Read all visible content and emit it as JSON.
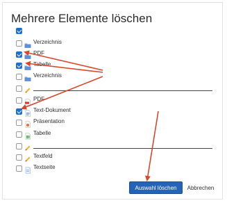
{
  "dialog": {
    "title": "Mehrere Elemente löschen",
    "select_all_checked": true,
    "items": [
      {
        "label": "Verzeichnis",
        "icon": "folder-icon",
        "checked": false
      },
      {
        "label": "PDF",
        "icon": "folder-icon",
        "checked": true
      },
      {
        "label": "Tabelle",
        "icon": "folder-icon",
        "checked": true
      },
      {
        "label": "Verzeichnis",
        "icon": "folder-icon",
        "checked": false
      },
      {
        "label": "",
        "icon": "pencil-icon",
        "checked": false
      },
      {
        "label": "PDF",
        "icon": "pdf-icon",
        "checked": false
      },
      {
        "label": "Text-Dokument",
        "icon": "document-icon",
        "checked": true
      },
      {
        "label": "Präsentation",
        "icon": "presentation-icon",
        "checked": false
      },
      {
        "label": "Tabelle",
        "icon": "spreadsheet-icon",
        "checked": false
      },
      {
        "label": "",
        "icon": "pencil-icon",
        "checked": false
      },
      {
        "label": "Textfeld",
        "icon": "pencil-icon",
        "checked": false
      },
      {
        "label": "Textseite",
        "icon": "page-icon",
        "checked": false
      }
    ],
    "delete_button": "Auswahl löschen",
    "cancel_button": "Abbrechen"
  },
  "colors": {
    "checkbox_checked": "#1f6fd0",
    "primary_button": "#2563b6",
    "annotation_arrow": "#d9472b",
    "folder": "#7aa7e6"
  }
}
